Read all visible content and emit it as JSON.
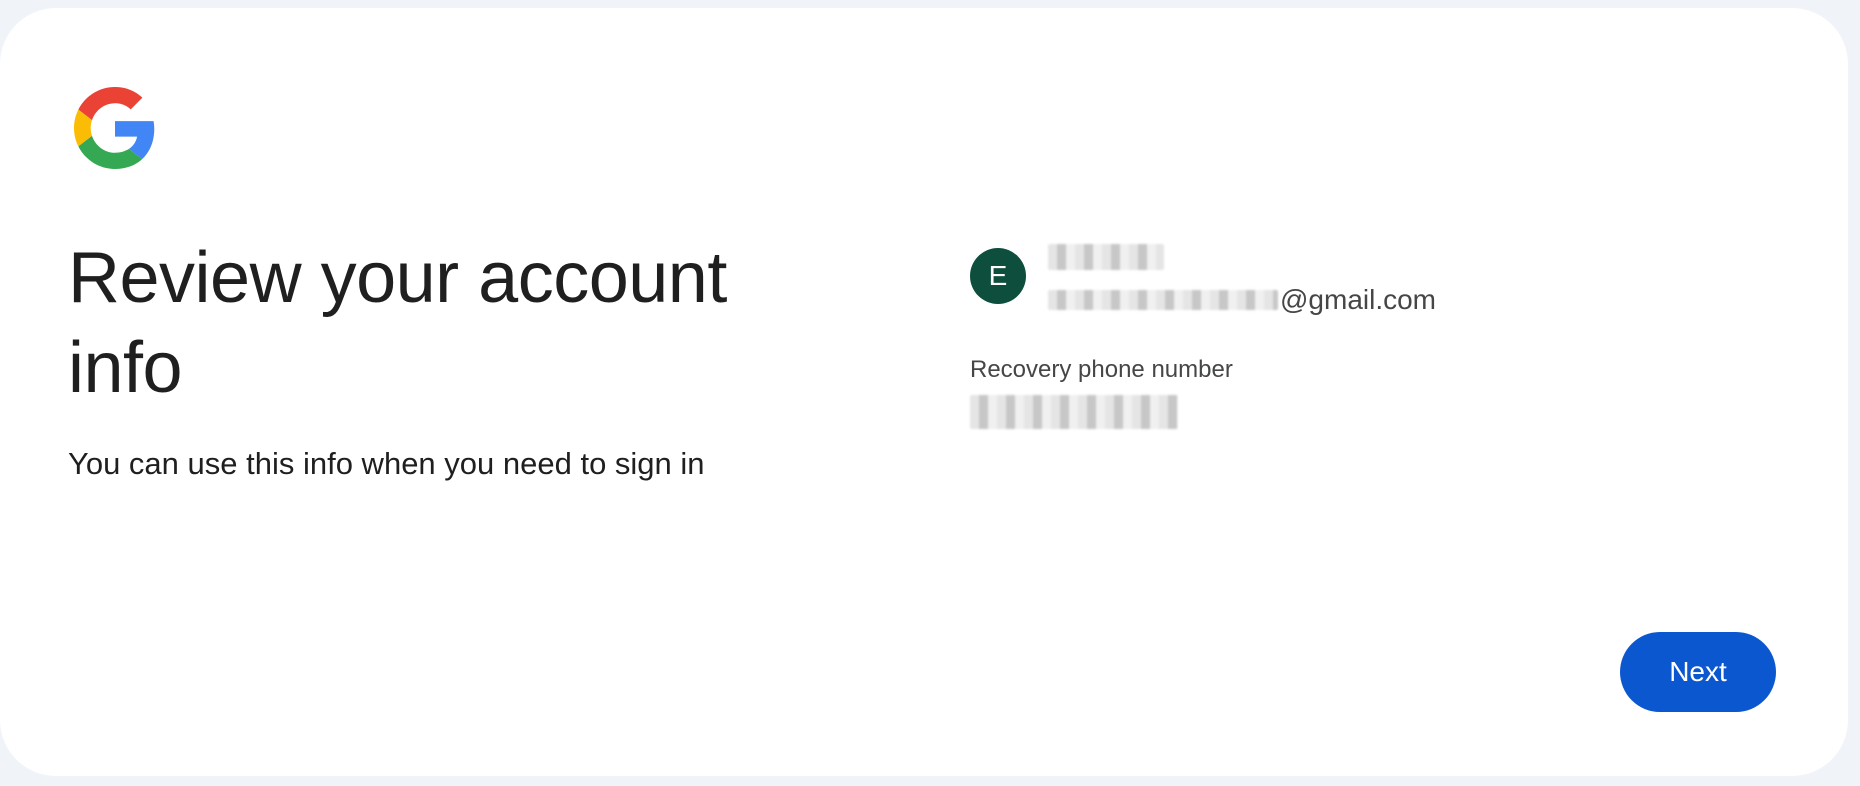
{
  "brand": {
    "logo_icon": "google-g-logo-icon",
    "colors": {
      "red": "#ea4335",
      "yellow": "#fbbc05",
      "green": "#34a853",
      "blue": "#4285f4"
    }
  },
  "main": {
    "title": "Review your account info",
    "subtitle": "You can use this info when you need to sign in"
  },
  "account": {
    "avatar_initial": "E",
    "avatar_color": "#0d4f3c",
    "email_domain": "@gmail.com",
    "recovery_label": "Recovery phone number"
  },
  "actions": {
    "next_label": "Next",
    "next_color": "#0b57d0"
  }
}
